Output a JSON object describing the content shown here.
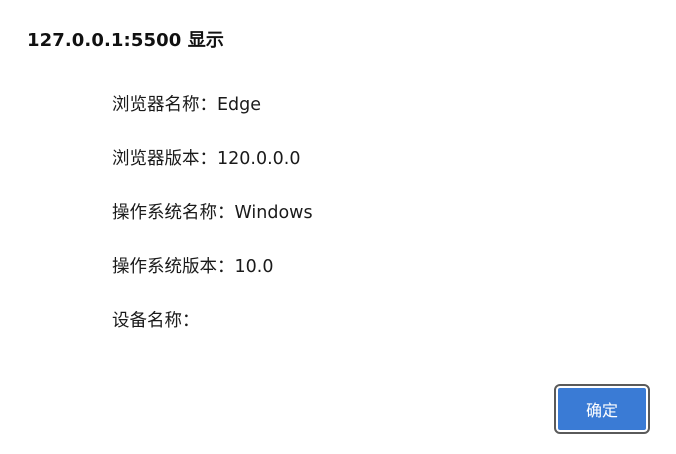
{
  "dialog": {
    "title": "127.0.0.1:5500 显示",
    "lines": [
      "浏览器名称：Edge",
      "浏览器版本：120.0.0.0",
      "操作系统名称：Windows",
      "操作系统版本：10.0",
      "设备名称："
    ],
    "ok_label": "确定"
  },
  "colors": {
    "button_bg": "#3a7bd5",
    "button_text": "#ffffff",
    "background": "#ffffff"
  }
}
